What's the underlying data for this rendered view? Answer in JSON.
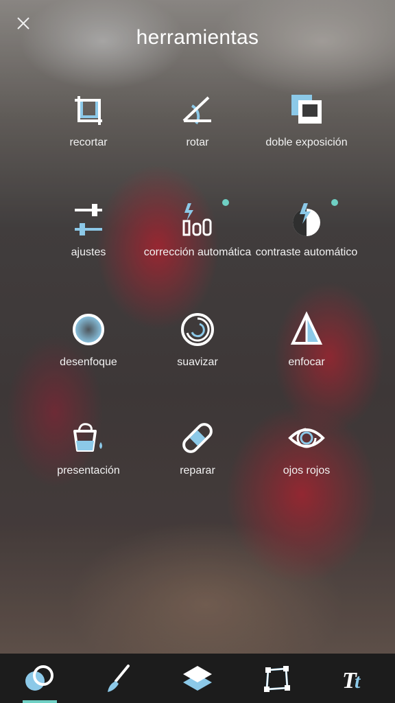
{
  "header": {
    "title": "herramientas",
    "close_icon": "close-icon"
  },
  "tools": [
    {
      "id": "crop",
      "label": "recortar",
      "icon": "crop-icon",
      "badge": false
    },
    {
      "id": "rotate",
      "label": "rotar",
      "icon": "rotate-icon",
      "badge": false
    },
    {
      "id": "double-exposure",
      "label": "doble exposición",
      "icon": "double-exposure-icon",
      "badge": false
    },
    {
      "id": "adjust",
      "label": "ajustes",
      "icon": "adjust-sliders-icon",
      "badge": false
    },
    {
      "id": "auto-fix",
      "label": "corrección automática",
      "icon": "auto-fix-icon",
      "badge": true
    },
    {
      "id": "auto-contrast",
      "label": "contraste automático",
      "icon": "auto-contrast-icon",
      "badge": true
    },
    {
      "id": "blur",
      "label": "desenfoque",
      "icon": "blur-icon",
      "badge": false
    },
    {
      "id": "smooth",
      "label": "suavizar",
      "icon": "smooth-icon",
      "badge": false
    },
    {
      "id": "sharpen",
      "label": "enfocar",
      "icon": "sharpen-icon",
      "badge": false
    },
    {
      "id": "splash",
      "label": "presentación",
      "icon": "paint-bucket-icon",
      "badge": false
    },
    {
      "id": "heal",
      "label": "reparar",
      "icon": "bandage-icon",
      "badge": false
    },
    {
      "id": "red-eye",
      "label": "ojos rojos",
      "icon": "eye-icon",
      "badge": false
    }
  ],
  "tabbar": {
    "tabs": [
      {
        "id": "tools",
        "icon": "tools-circles-icon",
        "active": true
      },
      {
        "id": "brush",
        "icon": "brush-icon",
        "active": false
      },
      {
        "id": "layers",
        "icon": "layers-icon",
        "active": false
      },
      {
        "id": "frames",
        "icon": "frame-icon",
        "active": false
      },
      {
        "id": "text",
        "icon": "text-tt-icon",
        "active": false
      }
    ]
  },
  "colors": {
    "accent": "#6fd0c4",
    "icon_blue": "#8cc9e8",
    "tabbar_bg": "#1c1c1c",
    "text": "#ffffff"
  }
}
